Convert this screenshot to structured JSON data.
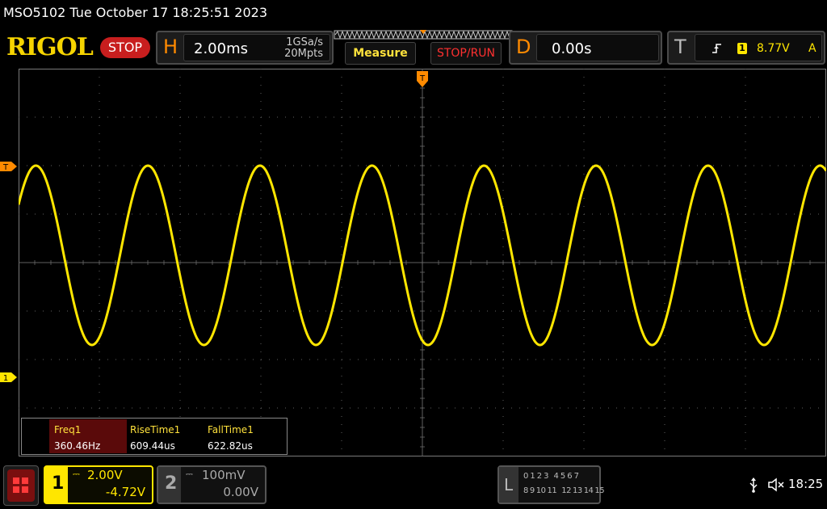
{
  "header": {
    "title": "MSO5102  Tue October 17 18:25:51 2023",
    "logo": "RIGOL",
    "run_state": "STOP"
  },
  "horizontal": {
    "letter": "H",
    "timebase": "2.00ms",
    "sample_rate": "1GSa/s",
    "memory_depth": "20Mpts"
  },
  "buttons": {
    "measure": "Measure",
    "stop_run": "STOP/RUN"
  },
  "delay": {
    "letter": "D",
    "value": "0.00s"
  },
  "trigger": {
    "letter": "T",
    "channel": "1",
    "level": "8.77V",
    "mode": "A"
  },
  "markers": {
    "trigger_top": "T",
    "trigger_left": "T",
    "channel1_ground": "1"
  },
  "measurements": {
    "headers": [
      "Freq1",
      "RiseTime1",
      "FallTime1"
    ],
    "values": [
      "360.46Hz",
      "609.44us",
      "622.82us"
    ]
  },
  "channels": [
    {
      "number": "1",
      "scale": "2.00V",
      "offset": "-4.72V",
      "color": "#ffe600"
    },
    {
      "number": "2",
      "scale": "100mV",
      "offset": "0.00V",
      "color": "#808080"
    }
  ],
  "logic": {
    "letter": "L",
    "row1": [
      "0",
      "1",
      "2",
      "3",
      "4",
      "5",
      "6",
      "7"
    ],
    "row2": [
      "8",
      "9",
      "10",
      "11",
      "12",
      "13",
      "14",
      "15"
    ]
  },
  "status": {
    "time": "18:25"
  },
  "waveform": {
    "type": "sine",
    "color": "#ffe600",
    "frequency_hz": 360.46,
    "time_per_div_ms": 2.0,
    "volts_per_div": 2.0,
    "channel_offset_v": -4.72,
    "peak_v": 4.0,
    "trough_v": -3.4
  },
  "colors": {
    "accent_orange": "#ff8a00",
    "stop_red": "#c81e1e",
    "logo_yellow": "#f6d400"
  }
}
